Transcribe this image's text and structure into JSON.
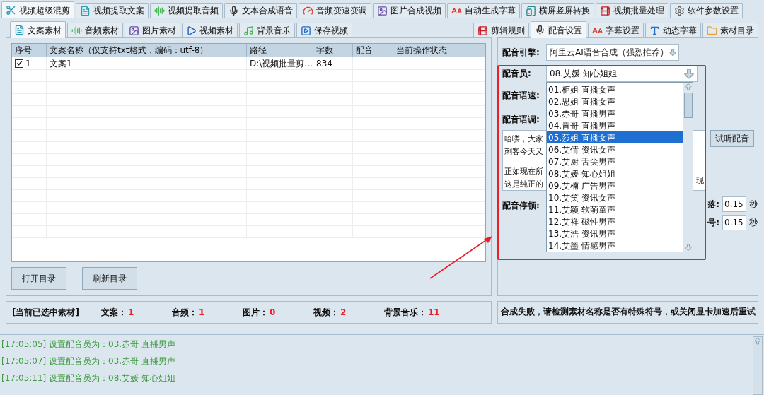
{
  "main_tabs": [
    {
      "label": "视频超级混剪",
      "selected": true
    },
    {
      "label": "视频提取文案",
      "selected": false
    },
    {
      "label": "视频提取音频",
      "selected": false
    },
    {
      "label": "文本合成语音",
      "selected": false
    },
    {
      "label": "音频变速变调",
      "selected": false
    },
    {
      "label": "图片合成视频",
      "selected": false
    },
    {
      "label": "自动生成字幕",
      "selected": false
    },
    {
      "label": "横屏竖屏转换",
      "selected": false
    },
    {
      "label": "视频批量处理",
      "selected": false
    },
    {
      "label": "软件参数设置",
      "selected": false
    }
  ],
  "material_tabs": [
    {
      "label": "文案素材",
      "selected": true
    },
    {
      "label": "音频素材",
      "selected": false
    },
    {
      "label": "图片素材",
      "selected": false
    },
    {
      "label": "视频素材",
      "selected": false
    },
    {
      "label": "背景音乐",
      "selected": false
    },
    {
      "label": "保存视频",
      "selected": false
    }
  ],
  "table": {
    "columns": [
      "序号",
      "文案名称（仅支持txt格式，编码：utf-8）",
      "路径",
      "字数",
      "配音",
      "当前操作状态"
    ],
    "rows": [
      {
        "checked": true,
        "cells": [
          "1",
          "文案1",
          "D:\\视频批量剪...",
          "834",
          "",
          ""
        ]
      }
    ]
  },
  "buttons": [
    "打开目录",
    "刷新目录"
  ],
  "selection_status": {
    "title": "[当前已选中素材]",
    "counts": [
      {
        "label": "文案：",
        "value": "1"
      },
      {
        "label": "音频：",
        "value": "1"
      },
      {
        "label": "图片：",
        "value": "0"
      },
      {
        "label": "视频：",
        "value": "2"
      },
      {
        "label": "背景音乐：",
        "value": "11"
      }
    ]
  },
  "settings_tabs": [
    {
      "label": "剪辑规则",
      "selected": false
    },
    {
      "label": "配音设置",
      "selected": true
    },
    {
      "label": "字幕设置",
      "selected": false
    },
    {
      "label": "动态字幕",
      "selected": false
    },
    {
      "label": "素材目录",
      "selected": false
    }
  ],
  "voice_settings": {
    "engine_label": "配音引擎:",
    "engine_value": "阿里云AI语音合成（强烈推荐）",
    "voice_label": "配音员:",
    "voice_value": "08.艾媛 知心姐姐",
    "voice_options": [
      {
        "label": "01.柜姐 直播女声",
        "selected": false
      },
      {
        "label": "02.思姐 直播女声",
        "selected": false
      },
      {
        "label": "03.赤哥 直播男声",
        "selected": false
      },
      {
        "label": "04.肯哥 直播男声",
        "selected": false
      },
      {
        "label": "05.莎姐 直播女声",
        "selected": true
      },
      {
        "label": "06.艾倩 资讯女声",
        "selected": false
      },
      {
        "label": "07.艾厨 舌尖男声",
        "selected": false
      },
      {
        "label": "08.艾媛 知心姐姐",
        "selected": false
      },
      {
        "label": "09.艾楠 广告男声",
        "selected": false
      },
      {
        "label": "10.艾笑 资讯女声",
        "selected": false
      },
      {
        "label": "11.艾颖 软萌童声",
        "selected": false
      },
      {
        "label": "12.艾祥 磁性男声",
        "selected": false
      },
      {
        "label": "13.艾浩 资讯男声",
        "selected": false
      },
      {
        "label": "14.艾墨 情感男声",
        "selected": false
      }
    ],
    "speed_label": "配音语速:",
    "pitch_label": "配音语调:",
    "sample_text_lines": [
      "哈喽，大家",
      "刺客今天又",
      "正如现在所",
      "这是纯正的"
    ],
    "sample_text_fragment": "现",
    "preview_button": "试听配音",
    "pause_label": "配音停顿:",
    "pauses": [
      {
        "label": "落:",
        "value": "0.15",
        "unit": "秒"
      },
      {
        "label": "号:",
        "value": "0.15",
        "unit": "秒"
      }
    ]
  },
  "error_message": "合成失败，请检测素材名称是否有特殊符号，或关闭显卡加速后重试",
  "log": [
    "[17:05:05] 设置配音员为：03.赤哥 直播男声",
    "[17:05:07] 设置配音员为：03.赤哥 直播男声",
    "[17:05:11] 设置配音员为：08.艾媛 知心姐姐"
  ]
}
